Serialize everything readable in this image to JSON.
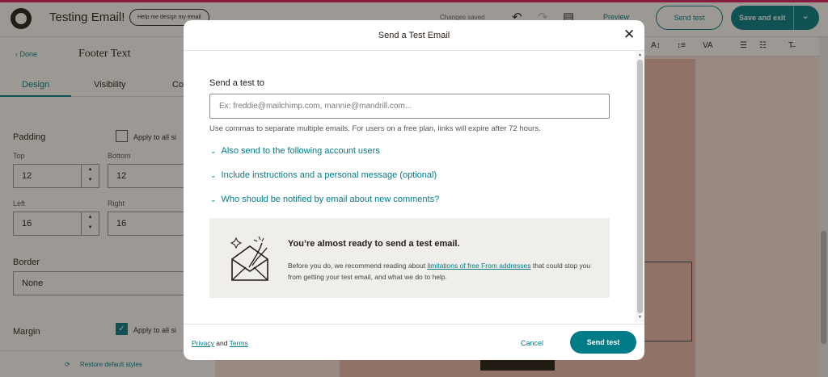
{
  "app": {
    "title": "Testing Email!",
    "help_pill": "Help me design my email",
    "changes_status": "Changes saved",
    "preview_label": "Preview",
    "send_test_label": "Send test",
    "save_exit_label": "Save and exit"
  },
  "left_panel": {
    "done_label": "Done",
    "title": "Footer Text",
    "tabs": [
      "Design",
      "Visibility",
      "Co"
    ],
    "padding": {
      "label": "Padding",
      "apply_all": "Apply to all si",
      "top_label": "Top",
      "top_value": "12",
      "bottom_label": "Bottom",
      "bottom_value": "12",
      "left_label": "Left",
      "left_value": "16",
      "right_label": "Right",
      "right_value": "16"
    },
    "border": {
      "label": "Border",
      "value": "None"
    },
    "margin": {
      "label": "Margin",
      "apply_all": "Apply to all si"
    },
    "restore_label": "Restore default styles"
  },
  "modal": {
    "title": "Send a Test Email",
    "field_label": "Send a test to",
    "input_placeholder": "Ex: freddie@mailchimp.com, mannie@mandrill.com...",
    "input_value": "",
    "hint": "Use commas to separate multiple emails. For users on a free plan, links will expire after 72 hours.",
    "expanders": [
      "Also send to the following account users",
      "Include instructions and a personal message (optional)",
      "Who should be notified by email about new comments?"
    ],
    "notice": {
      "title": "You’re almost ready to send a test email.",
      "body_before": "Before you do, we recommend reading about ",
      "body_link": "limitations of free From addresses",
      "body_after": " that could stop you from getting your test email, and what we do to help."
    },
    "footer": {
      "privacy": "Privacy",
      "and": " and ",
      "terms": "Terms",
      "cancel": "Cancel",
      "send": "Send test"
    }
  },
  "colors": {
    "accent": "#007c89",
    "brand_pink": "#d81b60",
    "overlay": "rgba(36,28,21,0.45)"
  }
}
